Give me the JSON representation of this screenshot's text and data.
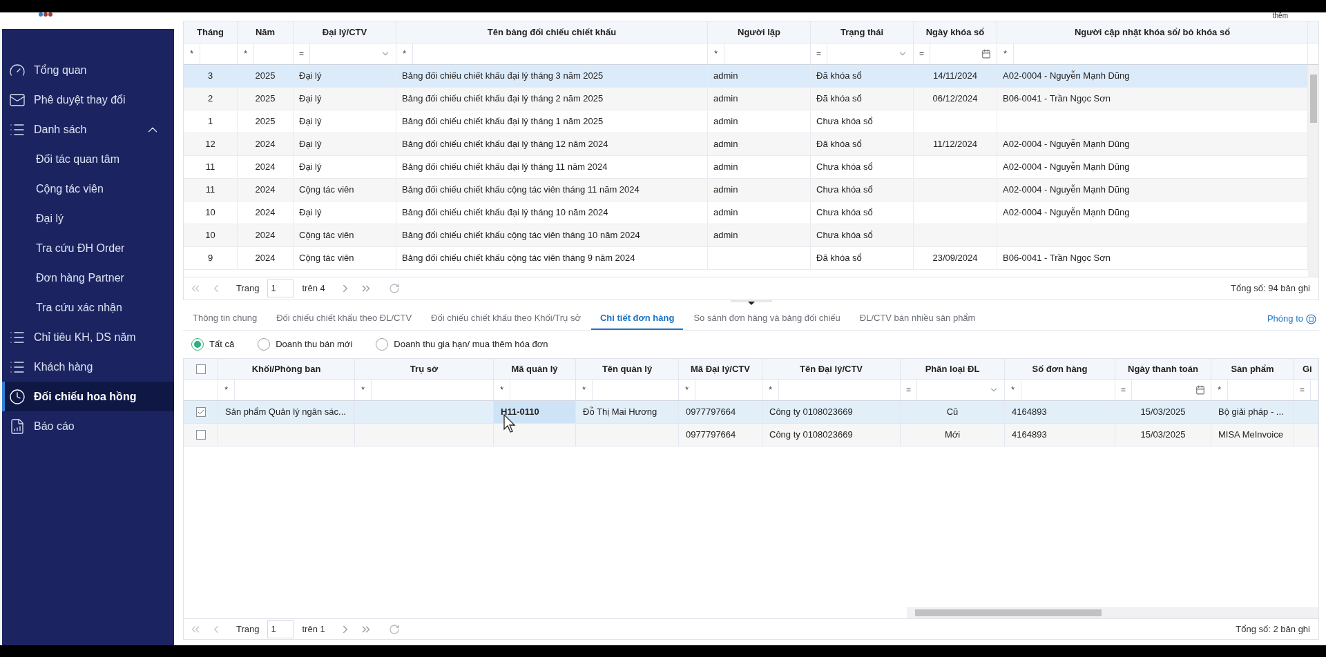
{
  "top_right_text": "thêm",
  "sidebar": {
    "items": [
      {
        "label": "Tổng quan",
        "selected": false
      },
      {
        "label": "Phê duyệt thay đổi",
        "selected": false
      },
      {
        "label": "Danh sách",
        "selected": false,
        "expanded": true,
        "children": [
          {
            "label": "Đối tác quan tâm",
            "selected": false
          },
          {
            "label": "Cộng tác viên",
            "selected": false
          },
          {
            "label": "Đại lý",
            "selected": false
          },
          {
            "label": "Tra cứu ĐH Order",
            "selected": false
          },
          {
            "label": "Đơn hàng Partner",
            "selected": false
          },
          {
            "label": "Tra cứu xác nhận",
            "selected": false
          }
        ]
      },
      {
        "label": "Chỉ tiêu KH, DS năm",
        "selected": false
      },
      {
        "label": "Khách hàng",
        "selected": false
      },
      {
        "label": "Đối chiếu hoa hồng",
        "selected": true
      },
      {
        "label": "Báo cáo",
        "selected": false
      }
    ]
  },
  "top_table": {
    "columns": [
      {
        "label": "Tháng",
        "filter_operator": "*",
        "kind": "text"
      },
      {
        "label": "Năm",
        "filter_operator": "*",
        "kind": "text"
      },
      {
        "label": "Đại lý/CTV",
        "filter_operator": "=",
        "kind": "select"
      },
      {
        "label": "Tên bảng đối chiếu chiết khấu",
        "filter_operator": "*",
        "kind": "text"
      },
      {
        "label": "Người lập",
        "filter_operator": "*",
        "kind": "text"
      },
      {
        "label": "Trạng thái",
        "filter_operator": "=",
        "kind": "select"
      },
      {
        "label": "Ngày khóa sổ",
        "filter_operator": "=",
        "kind": "date"
      },
      {
        "label": "Người cập nhật khóa sổ/ bỏ khóa sổ",
        "filter_operator": "*",
        "kind": "text"
      }
    ],
    "rows": [
      {
        "selected": true,
        "cells": [
          "3",
          "2025",
          "Đại lý",
          "Bảng đối chiếu chiết khấu đại lý tháng 3 năm 2025",
          "admin",
          "Đã khóa sổ",
          "14/11/2024",
          "A02-0004 - Nguyễn Mạnh Dũng"
        ]
      },
      {
        "selected": false,
        "cells": [
          "2",
          "2025",
          "Đại lý",
          "Bảng đối chiếu chiết khấu đại lý tháng 2 năm 2025",
          "admin",
          "Đã khóa sổ",
          "06/12/2024",
          "B06-0041 - Trần Ngọc Sơn"
        ]
      },
      {
        "selected": false,
        "cells": [
          "1",
          "2025",
          "Đại lý",
          "Bảng đối chiếu chiết khấu đại lý tháng 1 năm 2025",
          "admin",
          "Chưa khóa sổ",
          null,
          null
        ]
      },
      {
        "selected": false,
        "cells": [
          "12",
          "2024",
          "Đại lý",
          "Bảng đối chiếu chiết khấu đại lý tháng 12 năm 2024",
          "admin",
          "Đã khóa sổ",
          "11/12/2024",
          "A02-0004 - Nguyễn Mạnh Dũng"
        ]
      },
      {
        "selected": false,
        "cells": [
          "11",
          "2024",
          "Đại lý",
          "Bảng đối chiếu chiết khấu đại lý tháng 11 năm 2024",
          "admin",
          "Chưa khóa sổ",
          null,
          "A02-0004 - Nguyễn Mạnh Dũng"
        ]
      },
      {
        "selected": false,
        "cells": [
          "11",
          "2024",
          "Cộng tác viên",
          "Bảng đối chiếu chiết khấu cộng tác viên tháng 11 năm 2024",
          "admin",
          "Chưa khóa sổ",
          null,
          "A02-0004 - Nguyễn Mạnh Dũng"
        ]
      },
      {
        "selected": false,
        "cells": [
          "10",
          "2024",
          "Đại lý",
          "Bảng đối chiếu chiết khấu đại lý tháng 10 năm 2024",
          "admin",
          "Chưa khóa sổ",
          null,
          "A02-0004 - Nguyễn Mạnh Dũng"
        ]
      },
      {
        "selected": false,
        "cells": [
          "10",
          "2024",
          "Cộng tác viên",
          "Bảng đối chiếu chiết khấu cộng tác viên tháng 10 năm 2024",
          "admin",
          "Chưa khóa sổ",
          null,
          null
        ]
      },
      {
        "selected": false,
        "cells": [
          "9",
          "2024",
          "Cộng tác viên",
          "Bảng đối chiếu chiết khấu cộng tác viên tháng 9 năm 2024",
          null,
          "Đã khóa sổ",
          "23/09/2024",
          "B06-0041 - Trần Ngọc Sơn"
        ]
      }
    ],
    "pagination": {
      "page_label": "Trang",
      "page": "1",
      "of": "trên 4",
      "total": "Tổng số: 94 bản ghi"
    }
  },
  "tabs": [
    {
      "label": "Thông tin chung",
      "selected": false
    },
    {
      "label": "Đối chiếu chiết khấu theo ĐL/CTV",
      "selected": false
    },
    {
      "label": "Đối chiếu chiết khấu theo Khối/Trụ sở",
      "selected": false
    },
    {
      "label": "Chi tiết đơn hàng",
      "selected": true
    },
    {
      "label": "So sánh đơn hàng và bảng đối chiếu",
      "selected": false
    },
    {
      "label": "ĐL/CTV bán nhiều sản phẩm",
      "selected": false
    }
  ],
  "zoom_link": "Phóng to",
  "radio_options": [
    {
      "label": "Tất cả",
      "selected": true
    },
    {
      "label": "Doanh thu bán mới",
      "selected": false
    },
    {
      "label": "Doanh thu gia hạn/ mua thêm hóa đơn",
      "selected": false
    }
  ],
  "bottom_table": {
    "header_checked": false,
    "columns": [
      {
        "label": "Khối/Phòng ban",
        "filter_operator": "*",
        "kind": "text"
      },
      {
        "label": "Trụ sở",
        "filter_operator": "*",
        "kind": "text"
      },
      {
        "label": "Mã quản lý",
        "filter_operator": "*",
        "kind": "text"
      },
      {
        "label": "Tên quản lý",
        "filter_operator": "*",
        "kind": "text"
      },
      {
        "label": "Mã Đại lý/CTV",
        "filter_operator": "*",
        "kind": "text"
      },
      {
        "label": "Tên Đại lý/CTV",
        "filter_operator": "*",
        "kind": "text"
      },
      {
        "label": "Phân loại ĐL",
        "filter_operator": "=",
        "kind": "select"
      },
      {
        "label": "Số đơn hàng",
        "filter_operator": "*",
        "kind": "text"
      },
      {
        "label": "Ngày thanh toán",
        "filter_operator": "=",
        "kind": "date"
      },
      {
        "label": "Sản phẩm",
        "filter_operator": "*",
        "kind": "text"
      },
      {
        "label": "Gi",
        "filter_operator": "=",
        "kind": "text"
      }
    ],
    "rows": [
      {
        "checked": true,
        "selected": true,
        "cells": [
          {
            "text": "Sản phẩm Quản lý ngân sác...",
            "focused": false
          },
          {
            "text": null,
            "focused": false
          },
          {
            "text": "H11-0110",
            "focused": true
          },
          {
            "text": "Đỗ Thị Mai Hương",
            "focused": false
          },
          {
            "text": "0977797664",
            "focused": false
          },
          {
            "text": "Công ty 0108023669",
            "focused": false
          },
          {
            "text": "Cũ",
            "focused": false
          },
          {
            "text": "4164893",
            "focused": false
          },
          {
            "text": "15/03/2025",
            "focused": false
          },
          {
            "text": "Bộ giải pháp - ...",
            "focused": false
          },
          {
            "text": null,
            "focused": false
          }
        ]
      },
      {
        "checked": false,
        "selected": false,
        "cells": [
          {
            "text": null,
            "focused": false
          },
          {
            "text": null,
            "focused": false
          },
          {
            "text": null,
            "focused": false
          },
          {
            "text": null,
            "focused": false
          },
          {
            "text": "0977797664",
            "focused": false
          },
          {
            "text": "Công ty 0108023669",
            "focused": false
          },
          {
            "text": "Mới",
            "focused": false
          },
          {
            "text": "4164893",
            "focused": false
          },
          {
            "text": "15/03/2025",
            "focused": false
          },
          {
            "text": "MISA MeInvoice",
            "focused": false
          },
          {
            "text": null,
            "focused": false
          }
        ]
      }
    ],
    "pagination": {
      "page_label": "Trang",
      "page": "1",
      "of": "trên 1",
      "total": "Tổng số: 2 bản ghi"
    }
  }
}
